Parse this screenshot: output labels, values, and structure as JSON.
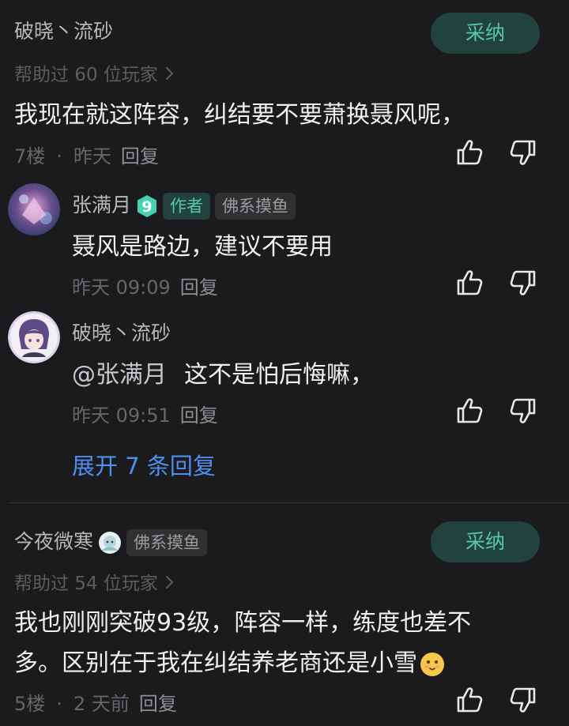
{
  "comments": [
    {
      "username": "破晓丶流砂",
      "helped": "帮助过 60 位玩家",
      "adopt_label": "采纳",
      "text": "我现在就这阵容，纠结要不要萧换聂风呢，",
      "floor": "7楼",
      "time": "昨天",
      "reply_label": "回复"
    },
    {
      "username": "今夜微寒",
      "badge": "佛系摸鱼",
      "helped": "帮助过 54 位玩家",
      "adopt_label": "采纳",
      "text_line1": "我也刚刚突破93级，阵容一样，练度也差不",
      "text_line2": "多。区别在于我在纠结养老商还是小雪",
      "floor": "5楼",
      "time": "2 天前",
      "reply_label": "回复"
    }
  ],
  "replies": [
    {
      "username": "张满月",
      "level": "9",
      "author_tag": "作者",
      "badge": "佛系摸鱼",
      "text": "聂风是路边，建议不要用",
      "time": "昨天 09:09",
      "reply_label": "回复"
    },
    {
      "username": "破晓丶流砂",
      "mention": "@张满月",
      "text": "这不是怕后悔嘛，",
      "time": "昨天 09:51",
      "reply_label": "回复"
    }
  ],
  "expand_label": "展开 7 条回复",
  "icons": [
    "thumbs-up-icon",
    "thumbs-down-icon",
    "chevron-right-icon",
    "level-badge-icon",
    "emoji-icon"
  ],
  "colors": {
    "background": "#1b1b1d",
    "accent_green": "#56c8a4",
    "adopt_bg": "#21433b",
    "link_blue": "#4f8df0"
  }
}
